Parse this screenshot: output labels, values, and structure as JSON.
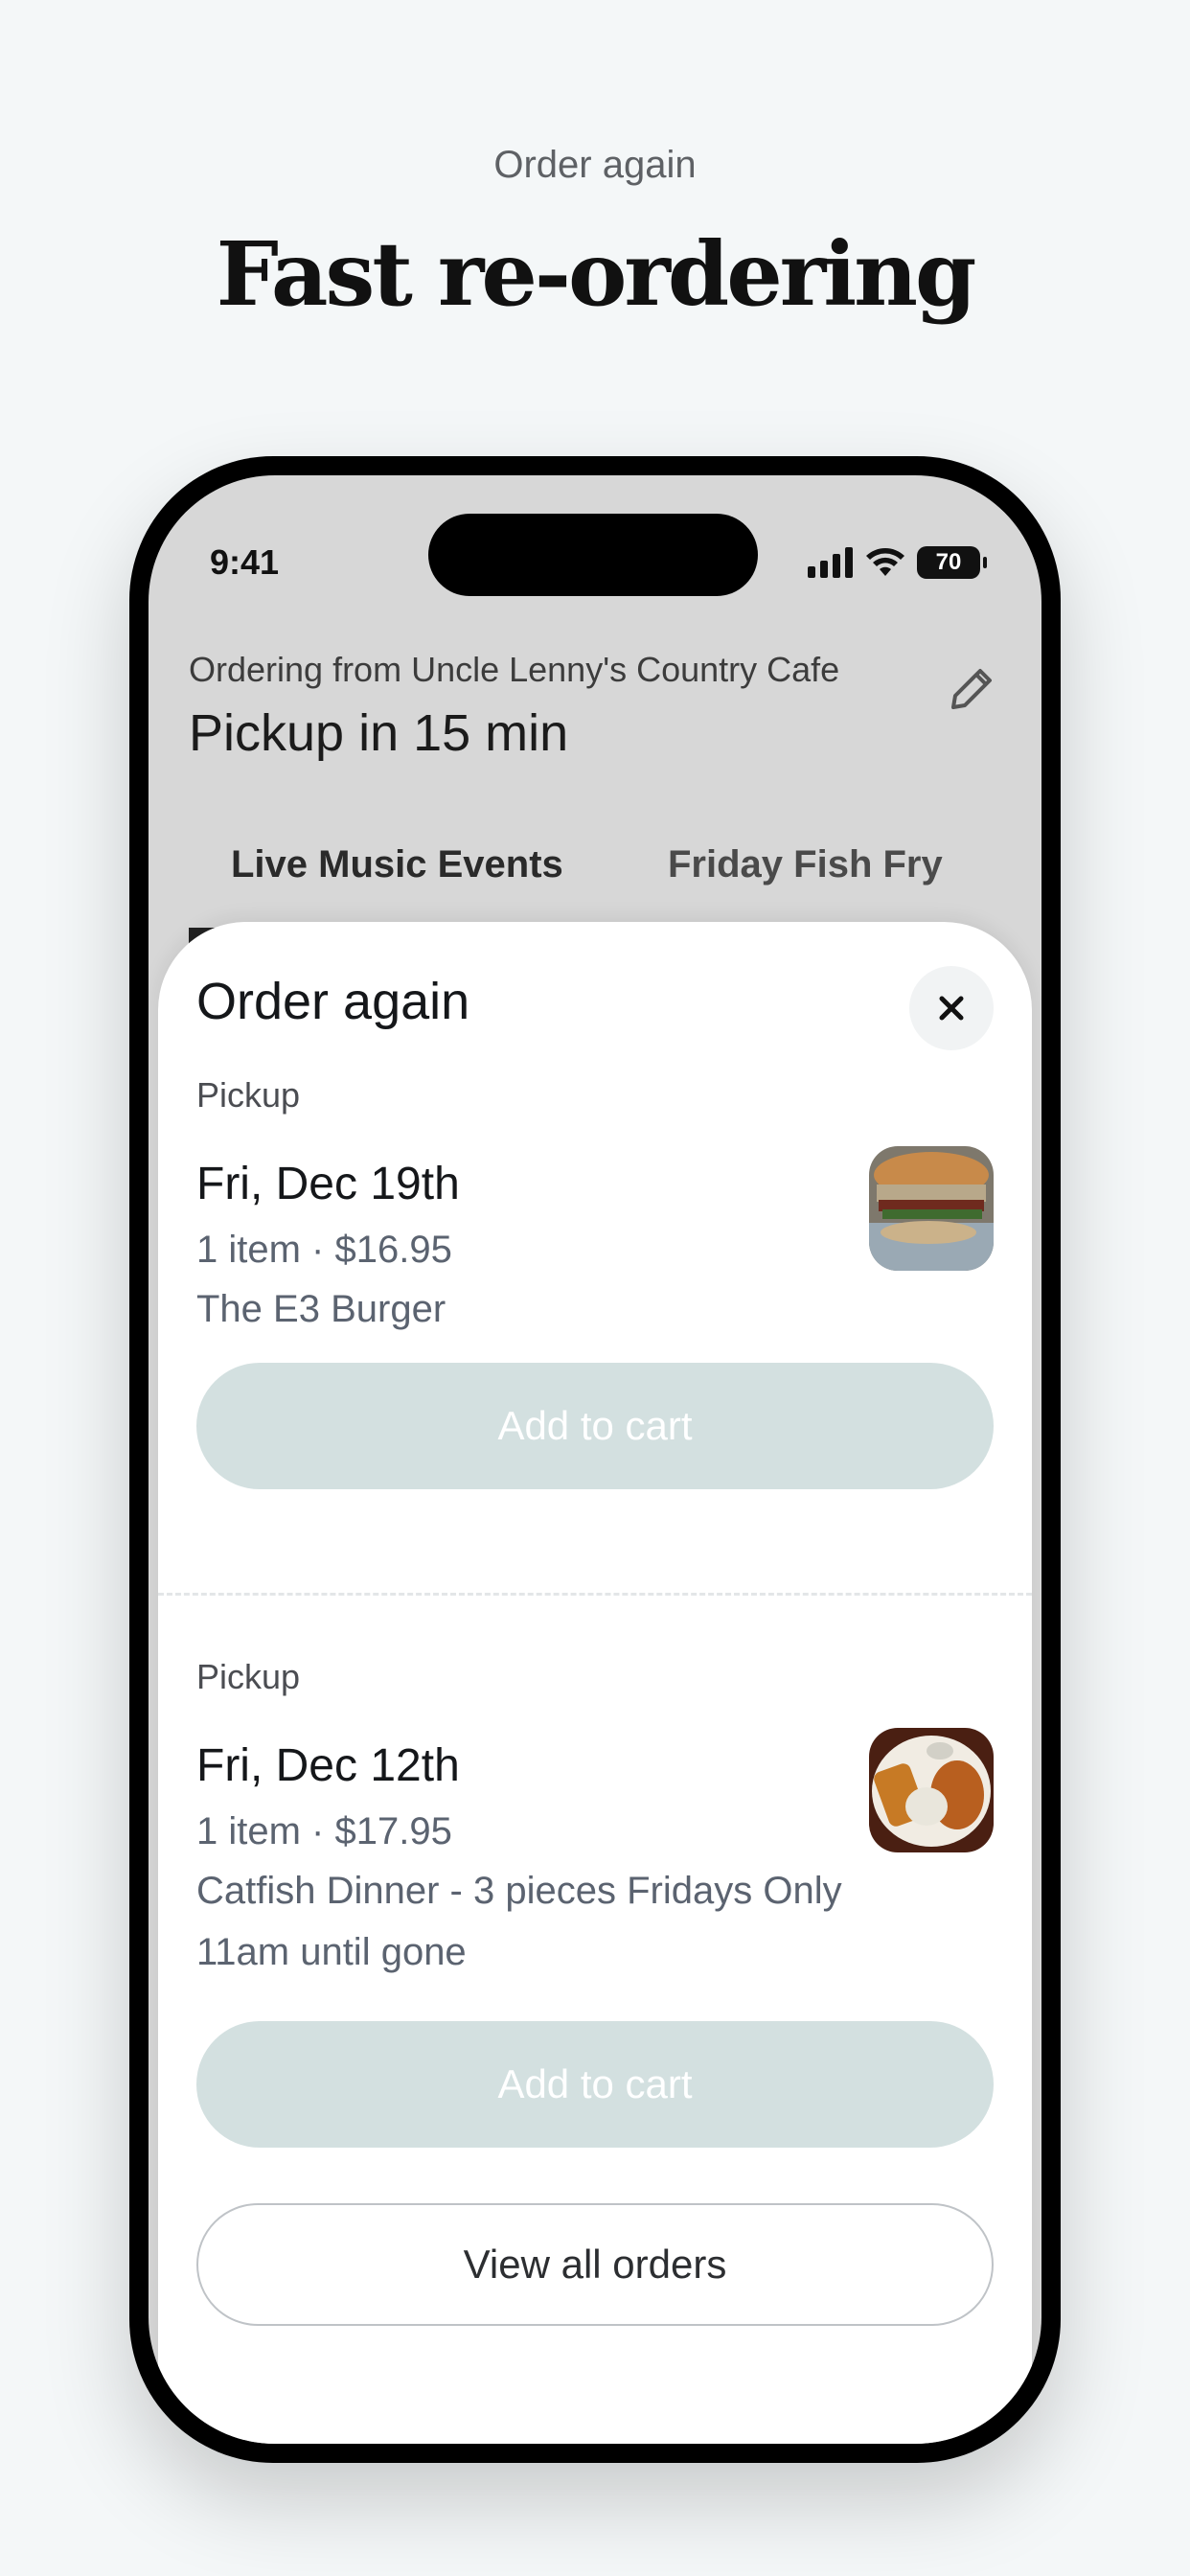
{
  "hero": {
    "kicker": "Order again",
    "title": "Fast re-ordering"
  },
  "status_bar": {
    "time": "9:41",
    "battery": "70"
  },
  "header": {
    "ordering_from": "Ordering from Uncle Lenny's Country Cafe",
    "pickup_time": "Pickup in 15 min"
  },
  "category_tabs": [
    "Live Music Events",
    "Friday Fish Fry"
  ],
  "sheet": {
    "title": "Order again",
    "orders": [
      {
        "mode": "Pickup",
        "date": "Fri, Dec 19th",
        "summary": "1 item · $16.95",
        "items": "The E3 Burger",
        "image_icon": "burger-thumbnail",
        "button": "Add to cart"
      },
      {
        "mode": "Pickup",
        "date": "Fri, Dec 12th",
        "summary": "1 item · $17.95",
        "items": "Catfish Dinner - 3 pieces Fridays Only 11am until gone",
        "image_icon": "catfish-dinner-thumbnail",
        "button": "Add to cart"
      }
    ],
    "view_all": "View all orders"
  },
  "colors": {
    "page_bg": "#f4f7f8",
    "add_button_bg": "#d3e0e0",
    "screen_bg": "#d7d7d7"
  }
}
